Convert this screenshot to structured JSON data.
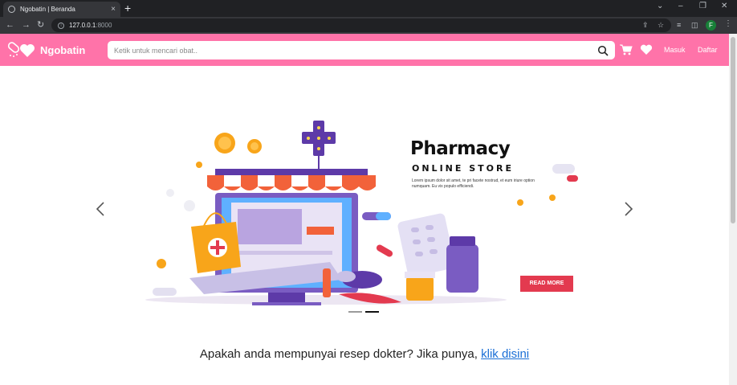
{
  "browser": {
    "tab_title": "Ngobatin | Beranda",
    "tab_close": "×",
    "new_tab": "+",
    "url_host": "127.0.0.1",
    "url_port": ":8000",
    "profile_initial": "F"
  },
  "header": {
    "brand": "Ngobatin",
    "search_placeholder": "Ketik untuk mencari obat..",
    "login_label": "Masuk",
    "register_label": "Daftar",
    "brand_color": "#ff73a9"
  },
  "banner": {
    "title": "Pharmacy",
    "subtitle": "ONLINE STORE",
    "lorem": "Lorem ipsum dolor sit amet, te pri facete nostrud, et eum iriure option numquam. Eu vix populo efficiendi.",
    "cta": "READ MORE",
    "indicators": [
      {
        "active": false
      },
      {
        "active": true
      }
    ]
  },
  "prescription": {
    "text": "Apakah anda mempunyai resep dokter? Jika punya,",
    "link": "klik disini"
  }
}
